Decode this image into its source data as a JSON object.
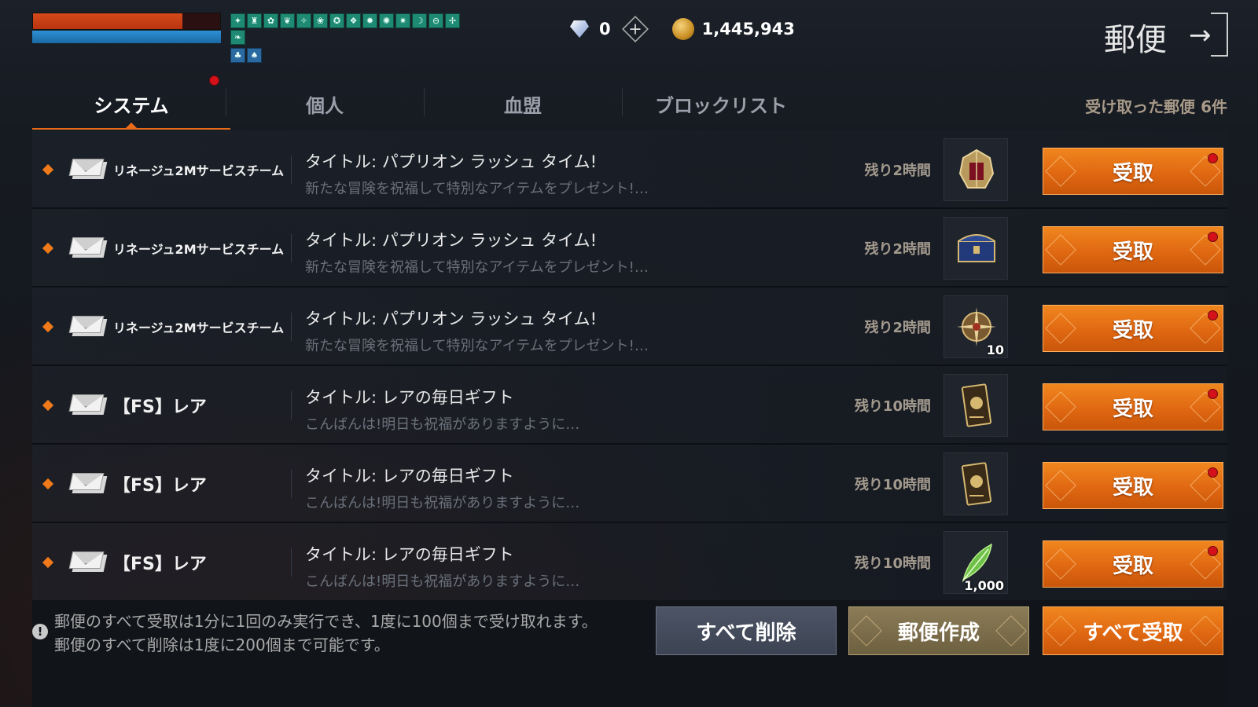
{
  "hud": {
    "hp_fraction": 0.8,
    "mp_fraction": 1.0,
    "buff_icons_row1": [
      "✦",
      "♜",
      "✿",
      "❦",
      "✧",
      "❀",
      "✪",
      "❖",
      "✹",
      "✺",
      "✷",
      "☽",
      "⊖",
      "✢",
      "❧"
    ],
    "buff_icons_row2": [
      "♣",
      "♠"
    ]
  },
  "currency": {
    "gems": "0",
    "gold": "1,445,943"
  },
  "window": {
    "title": "郵便"
  },
  "tabs": [
    {
      "label": "システム",
      "active": true,
      "has_notification": true
    },
    {
      "label": "個人",
      "active": false
    },
    {
      "label": "血盟",
      "active": false
    },
    {
      "label": "ブロックリスト",
      "active": false
    }
  ],
  "received_count_label": "受け取った郵便 6件",
  "mails": [
    {
      "sender": "リネージュ2Mサービスチーム",
      "title": "タイトル: パプリオン ラッシュ タイム!",
      "desc": "新たな冒険を祝福して特別なアイテムをプレゼント!…",
      "remaining": "残り2時間",
      "item_icon": "lantern-icon",
      "qty": "",
      "claim_label": "受取"
    },
    {
      "sender": "リネージュ2Mサービスチーム",
      "title": "タイトル: パプリオン ラッシュ タイム!",
      "desc": "新たな冒険を祝福して特別なアイテムをプレゼント!…",
      "remaining": "残り2時間",
      "item_icon": "chest-icon",
      "qty": "",
      "claim_label": "受取"
    },
    {
      "sender": "リネージュ2Mサービスチーム",
      "title": "タイトル: パプリオン ラッシュ タイム!",
      "desc": "新たな冒険を祝福して特別なアイテムをプレゼント!…",
      "remaining": "残り2時間",
      "item_icon": "compass-icon",
      "qty": "10",
      "claim_label": "受取"
    },
    {
      "sender": "【FS】レア",
      "title": "タイトル: レアの毎日ギフト",
      "desc": "こんばんは!明日も祝福がありますように…",
      "remaining": "残り10時間",
      "item_icon": "card-icon",
      "qty": "",
      "claim_label": "受取"
    },
    {
      "sender": "【FS】レア",
      "title": "タイトル: レアの毎日ギフト",
      "desc": "こんばんは!明日も祝福がありますように…",
      "remaining": "残り10時間",
      "item_icon": "card-icon",
      "qty": "",
      "claim_label": "受取"
    },
    {
      "sender": "【FS】レア",
      "title": "タイトル: レアの毎日ギフト",
      "desc": "こんばんは!明日も祝福がありますように…",
      "remaining": "残り10時間",
      "item_icon": "feather-icon",
      "qty": "1,000",
      "claim_label": "受取"
    }
  ],
  "footer": {
    "notice_line1": "郵便のすべて受取は1分に1回のみ実行でき、1度に100個まで受け取れます。",
    "notice_line2": "郵便のすべて削除は1度に200個まで可能です。",
    "delete_all": "すべて削除",
    "compose": "郵便作成",
    "claim_all": "すべて受取"
  },
  "colors": {
    "accent_orange": "#e06812",
    "notification_red": "#d4101a",
    "hp_red": "#d44a1a",
    "mp_blue": "#2e8fd4"
  }
}
